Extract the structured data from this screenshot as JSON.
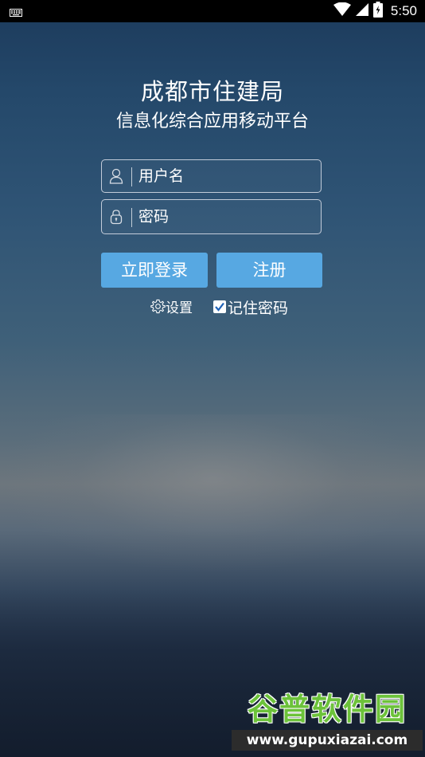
{
  "status_bar": {
    "time": "5:50",
    "icons": [
      "keyboard-icon",
      "wifi-icon",
      "signal-icon",
      "battery-icon"
    ]
  },
  "header": {
    "title": "成都市住建局",
    "subtitle": "信息化综合应用移动平台"
  },
  "form": {
    "username_placeholder": "用户名",
    "password_placeholder": "密码",
    "login_label": "立即登录",
    "register_label": "注册",
    "settings_label": "设置",
    "remember_label": "记住密码",
    "remember_checked": true
  },
  "watermark": {
    "name": "谷普软件园",
    "url": "www.gupuxiazai.com"
  },
  "colors": {
    "button": "#57a8e2",
    "watermark_green": "#6cc23a"
  }
}
